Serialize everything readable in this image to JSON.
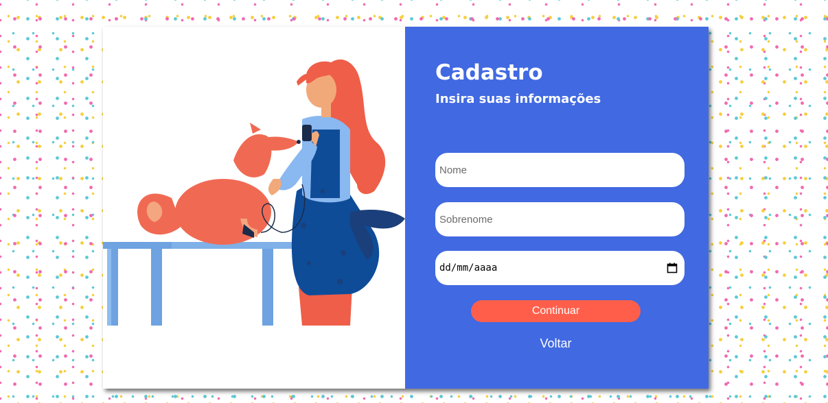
{
  "form": {
    "title": "Cadastro",
    "subtitle": "Insira suas informações",
    "first_name_placeholder": "Nome",
    "last_name_placeholder": "Sobrenome",
    "birthdate_placeholder": "dd/mm/aaaa",
    "continue_label": "Continuar",
    "back_label": "Voltar"
  },
  "illustration": {
    "icon": "groomer-with-dog-illustration"
  },
  "colors": {
    "panel_background": "#4169e1",
    "button_background": "#ff5f4a",
    "field_background": "#ffffff",
    "confetti": [
      "#f06bb0",
      "#5ec9d6",
      "#f6cf3f"
    ]
  }
}
